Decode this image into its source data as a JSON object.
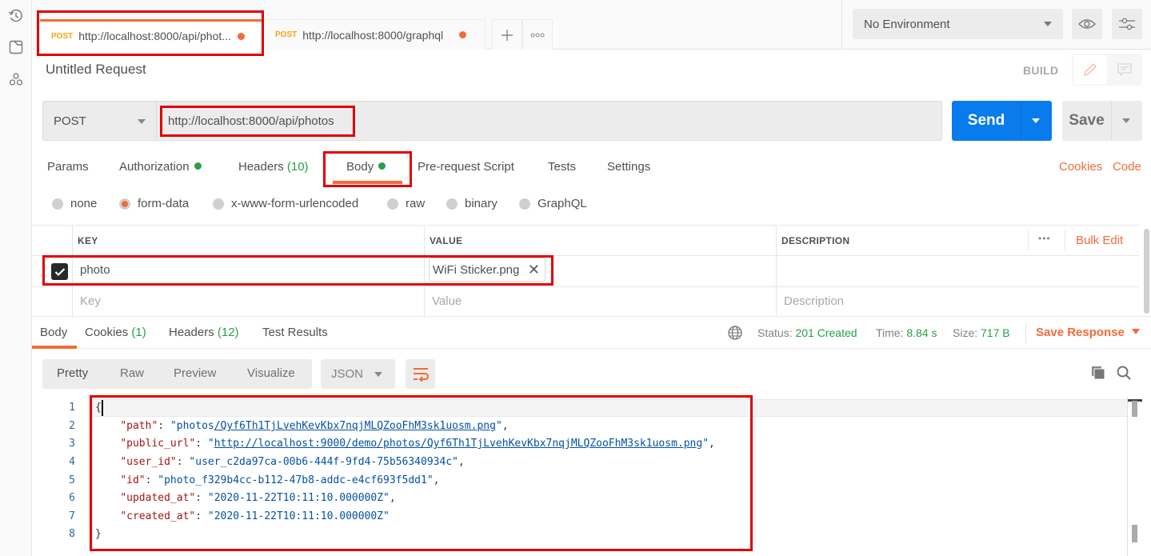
{
  "sidebar_rail": {
    "icons": [
      "history-icon",
      "collection-icon",
      "apis-icon"
    ]
  },
  "tabs": [
    {
      "method": "POST",
      "label": "http://localhost:8000/api/phot...",
      "unsaved": true,
      "active": true
    },
    {
      "method": "POST",
      "label": "http://localhost:8000/graphql",
      "unsaved": true,
      "active": false
    }
  ],
  "tab_actions": {
    "new_tab": "+",
    "more": "◦◦◦"
  },
  "environment": {
    "selected": "No Environment",
    "eye_icon": "eye-icon",
    "settings_icon": "sliders-icon"
  },
  "request": {
    "title": "Untitled Request",
    "mode_label": "BUILD",
    "method": "POST",
    "url": "http://localhost:8000/api/photos",
    "send_label": "Send",
    "save_label": "Save"
  },
  "request_tabs": [
    {
      "label": "Params"
    },
    {
      "label": "Authorization",
      "indicator": true
    },
    {
      "label": "Headers",
      "count": "(10)"
    },
    {
      "label": "Body",
      "indicator": true,
      "active": true
    },
    {
      "label": "Pre-request Script"
    },
    {
      "label": "Tests"
    },
    {
      "label": "Settings"
    }
  ],
  "request_links": {
    "cookies": "Cookies",
    "code": "Code"
  },
  "body_types": [
    {
      "label": "none",
      "selected": false
    },
    {
      "label": "form-data",
      "selected": true
    },
    {
      "label": "x-www-form-urlencoded",
      "selected": false
    },
    {
      "label": "raw",
      "selected": false
    },
    {
      "label": "binary",
      "selected": false
    },
    {
      "label": "GraphQL",
      "selected": false
    }
  ],
  "form_table": {
    "headers": {
      "key": "KEY",
      "value": "VALUE",
      "description": "DESCRIPTION"
    },
    "more": "•••",
    "bulk_edit": "Bulk Edit",
    "rows": [
      {
        "checked": true,
        "key": "photo",
        "value_file": "WiFi Sticker.png",
        "description": ""
      }
    ],
    "placeholders": {
      "key": "Key",
      "value": "Value",
      "description": "Description"
    }
  },
  "response": {
    "tabs": [
      {
        "label": "Body",
        "active": true
      },
      {
        "label": "Cookies",
        "count": "(1)"
      },
      {
        "label": "Headers",
        "count": "(12)"
      },
      {
        "label": "Test Results"
      }
    ],
    "status_label": "Status:",
    "status_value": "201 Created",
    "time_label": "Time:",
    "time_value": "8.84 s",
    "size_label": "Size:",
    "size_value": "717 B",
    "save_response": "Save Response",
    "view_modes": [
      "Pretty",
      "Raw",
      "Preview",
      "Visualize"
    ],
    "selected_view": "Pretty",
    "format": "JSON",
    "colors": {
      "accent": "#f26b3a",
      "success": "#26a146",
      "send": "#097bed"
    }
  },
  "response_body": {
    "line_numbers": [
      "1",
      "2",
      "3",
      "4",
      "5",
      "6",
      "7",
      "8"
    ],
    "lines": [
      {
        "open": "{"
      },
      {
        "key": "\"path\"",
        "value": "\"photos/Qyf6Th1TjLvehKevKbx7nqjMLQZooFhM3sk1uosm.png\"",
        "trail": ","
      },
      {
        "key": "\"public_url\"",
        "value": "\"http://localhost:9000/demo/photos/Qyf6Th1TjLvehKevKbx7nqjMLQZooFhM3sk1uosm.png\"",
        "trail": ","
      },
      {
        "key": "\"user_id\"",
        "value": "\"user_c2da97ca-00b6-444f-9fd4-75b56340934c\"",
        "trail": ","
      },
      {
        "key": "\"id\"",
        "value": "\"photo_f329b4cc-b112-47b8-addc-e4cf693f5dd1\"",
        "trail": ","
      },
      {
        "key": "\"updated_at\"",
        "value": "\"2020-11-22T10:11:10.000000Z\"",
        "trail": ","
      },
      {
        "key": "\"created_at\"",
        "value": "\"2020-11-22T10:11:10.000000Z\"",
        "trail": ""
      },
      {
        "close": "}"
      }
    ],
    "path_prefix": "\"photos",
    "path_link": "/Qyf6Th1TjLvehKevKbx7nqjMLQZooFhM3sk1uosm.png",
    "path_suffix": "\"",
    "url_prefix": "\"",
    "url_link": "http://localhost:9000/demo/photos/Qyf6Th1TjLvehKevKbx7nqjMLQZooFhM3sk1uosm.png",
    "url_suffix": "\""
  }
}
